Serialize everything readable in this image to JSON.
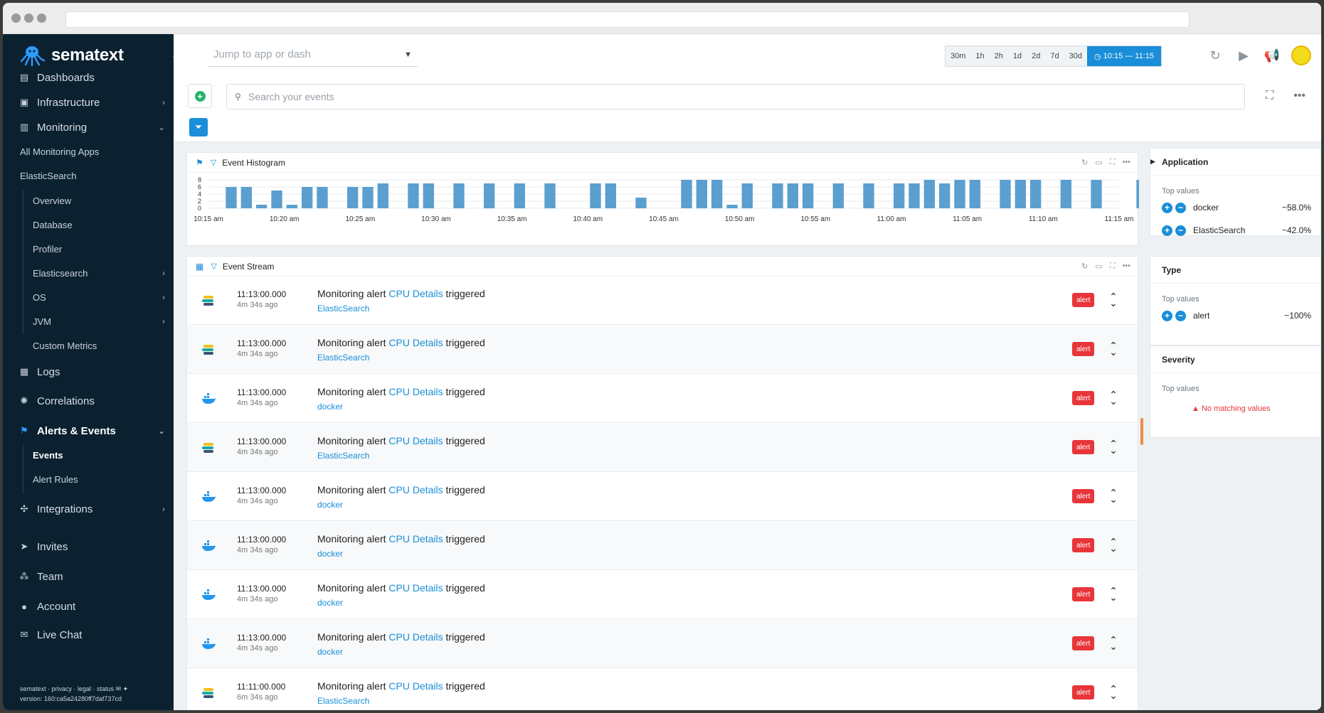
{
  "brand": {
    "name": "sematext"
  },
  "topbar": {
    "jump_placeholder": "Jump to app or dash",
    "time_ranges": [
      "30m",
      "1h",
      "2h",
      "1d",
      "2d",
      "7d",
      "30d"
    ],
    "time_active": "10:15 — 11:15"
  },
  "search": {
    "placeholder": "Search your events"
  },
  "sidebar": {
    "items": [
      {
        "label": "Dashboards",
        "icon": "dashboards-icon"
      },
      {
        "label": "Infrastructure",
        "icon": "infrastructure-icon"
      },
      {
        "label": "Monitoring",
        "icon": "monitoring-icon"
      },
      {
        "label": "Logs",
        "icon": "logs-icon"
      },
      {
        "label": "Correlations",
        "icon": "correlations-icon"
      },
      {
        "label": "Alerts & Events",
        "icon": "flag-icon"
      },
      {
        "label": "Integrations",
        "icon": "puzzle-icon"
      },
      {
        "label": "Invites",
        "icon": "send-icon"
      },
      {
        "label": "Team",
        "icon": "team-icon"
      },
      {
        "label": "Account",
        "icon": "user-icon"
      },
      {
        "label": "Live Chat",
        "icon": "chat-icon"
      }
    ],
    "monitoring_sub": [
      "All Monitoring Apps",
      "ElasticSearch"
    ],
    "elastic_sub": [
      "Overview",
      "Database",
      "Profiler",
      "Elasticsearch",
      "OS",
      "JVM",
      "Custom Metrics"
    ],
    "alerts_sub": [
      "Events",
      "Alert Rules"
    ],
    "footer_links": "sematext · privacy · legal · status",
    "version": "version: 160:ca5a24280ff7daf737cd"
  },
  "histogram": {
    "title": "Event Histogram",
    "chart_data": {
      "type": "bar",
      "ylim": [
        0,
        8
      ],
      "yticks": [
        "8",
        "6",
        "4",
        "2",
        "0"
      ],
      "xticks": [
        "10:15 am",
        "10:20 am",
        "10:25 am",
        "10:30 am",
        "10:35 am",
        "10:40 am",
        "10:45 am",
        "10:50 am",
        "10:55 am",
        "11:00 am",
        "11:05 am",
        "11:10 am",
        "11:15 am"
      ],
      "x_start": "10:15 am",
      "x_end": "11:15 am",
      "bins_per_tick": 5,
      "values": [
        0,
        6,
        6,
        1,
        5,
        1,
        6,
        6,
        0,
        6,
        6,
        7,
        0,
        7,
        7,
        0,
        7,
        0,
        7,
        0,
        7,
        0,
        7,
        0,
        0,
        7,
        7,
        0,
        3,
        0,
        0,
        8,
        8,
        8,
        1,
        7,
        0,
        7,
        7,
        7,
        0,
        7,
        0,
        7,
        0,
        7,
        7,
        8,
        7,
        8,
        8,
        0,
        8,
        8,
        8,
        0,
        8,
        0,
        8,
        0,
        0,
        8
      ]
    }
  },
  "stream": {
    "title": "Event Stream",
    "title_prefix": "Monitoring alert",
    "title_link": "CPU Details",
    "title_suffix": "triggered",
    "badge": "alert",
    "rows": [
      {
        "time": "11:13:00.000",
        "ago": "4m 34s ago",
        "app": "ElasticSearch",
        "icon": "elasticsearch-icon"
      },
      {
        "time": "11:13:00.000",
        "ago": "4m 34s ago",
        "app": "ElasticSearch",
        "icon": "elasticsearch-icon"
      },
      {
        "time": "11:13:00.000",
        "ago": "4m 34s ago",
        "app": "docker",
        "icon": "docker-icon"
      },
      {
        "time": "11:13:00.000",
        "ago": "4m 34s ago",
        "app": "ElasticSearch",
        "icon": "elasticsearch-icon"
      },
      {
        "time": "11:13:00.000",
        "ago": "4m 34s ago",
        "app": "docker",
        "icon": "docker-icon"
      },
      {
        "time": "11:13:00.000",
        "ago": "4m 34s ago",
        "app": "docker",
        "icon": "docker-icon"
      },
      {
        "time": "11:13:00.000",
        "ago": "4m 34s ago",
        "app": "docker",
        "icon": "docker-icon"
      },
      {
        "time": "11:13:00.000",
        "ago": "4m 34s ago",
        "app": "docker",
        "icon": "docker-icon"
      },
      {
        "time": "11:11:00.000",
        "ago": "6m 34s ago",
        "app": "ElasticSearch",
        "icon": "elasticsearch-icon"
      }
    ]
  },
  "facets": {
    "top_values_label": "Top values",
    "application": {
      "title": "Application",
      "values": [
        {
          "name": "docker",
          "pct": "~58.0%"
        },
        {
          "name": "ElasticSearch",
          "pct": "~42.0%"
        }
      ]
    },
    "type": {
      "title": "Type",
      "values": [
        {
          "name": "alert",
          "pct": "~100%"
        }
      ]
    },
    "severity": {
      "title": "Severity",
      "empty": "No matching values"
    }
  },
  "colors": {
    "accent": "#1a8ed8",
    "sidebar": "#0b2130",
    "alert": "#e8353a",
    "bar": "#5b9fd0"
  }
}
